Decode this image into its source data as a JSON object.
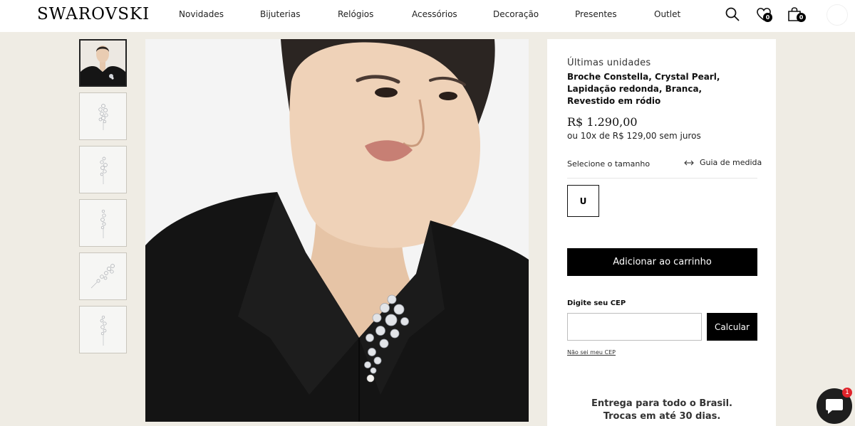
{
  "header": {
    "logo": "SWAROVSKI",
    "nav": [
      "Novidades",
      "Bijuterias",
      "Relógios",
      "Acessórios",
      "Decoração",
      "Presentes",
      "Outlet"
    ],
    "wishlist_count": "0",
    "cart_count": "0"
  },
  "gallery": {
    "thumbnail_count": 6,
    "active_index": 0
  },
  "product": {
    "stock_status": "Últimas unidades",
    "name": "Broche Constella, Crystal Pearl, Lapidação redonda, Branca, Revestido em ródio",
    "price": "R$ 1.290,00",
    "installments": "ou 10x de R$ 129,00 sem juros",
    "size_label": "Selecione o tamanho",
    "size_guide": "Guia de medida",
    "sizes": [
      "U"
    ],
    "add_to_cart": "Adicionar ao carrinho",
    "cep_label": "Digite seu CEP",
    "cep_placeholder": "",
    "calculate": "Calcular",
    "cep_link": "Não sei meu CEP",
    "delivery_info": "Entrega para todo o Brasil. Trocas em até 30 dias."
  },
  "chat": {
    "badge": "1"
  },
  "colors": {
    "page_background": "#efece4",
    "button": "#000000",
    "badge_red": "#e0242b"
  }
}
